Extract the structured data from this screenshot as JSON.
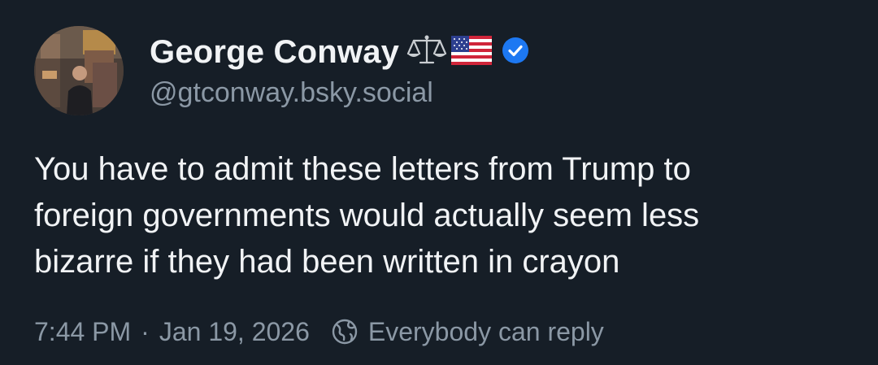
{
  "author": {
    "display_name": "George Conway",
    "name_emojis": [
      "scales-icon",
      "us-flag-icon"
    ],
    "verified_icon": "verified-check-icon",
    "handle": "@gtconway.bsky.social",
    "avatar": "profile-photo"
  },
  "post": {
    "lines": [
      "You have to admit these letters from Trump to",
      "foreign governments would actually seem less",
      "bizarre if they had been written in crayon"
    ]
  },
  "meta": {
    "time": "7:44 PM",
    "separator": "·",
    "date": "Jan 19, 2026",
    "reply_icon": "globe-reply-icon",
    "reply_setting": "Everybody can reply"
  },
  "colors": {
    "background": "#161e27",
    "text": "#f1f3f5",
    "muted": "#8b98a5",
    "verified": "#1d78f2"
  }
}
